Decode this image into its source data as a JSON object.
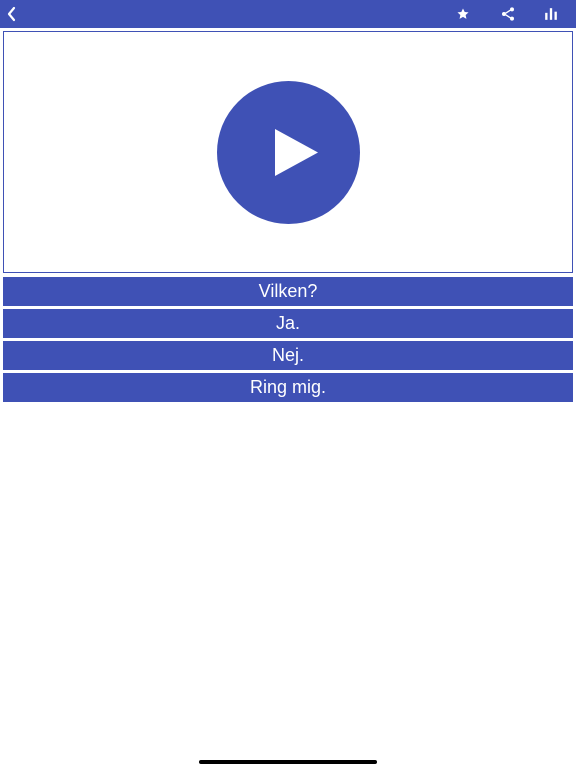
{
  "header": {
    "back_icon": "chevron-left-icon",
    "actions": [
      {
        "icon": "star-icon"
      },
      {
        "icon": "share-icon"
      },
      {
        "icon": "bar-chart-icon"
      }
    ]
  },
  "video": {
    "play_icon": "play-icon"
  },
  "phrases": [
    {
      "label": "Vilken?"
    },
    {
      "label": "Ja."
    },
    {
      "label": "Nej."
    },
    {
      "label": "Ring mig."
    }
  ],
  "colors": {
    "primary": "#3f51b5",
    "background": "#ffffff",
    "text_on_primary": "#ffffff"
  }
}
